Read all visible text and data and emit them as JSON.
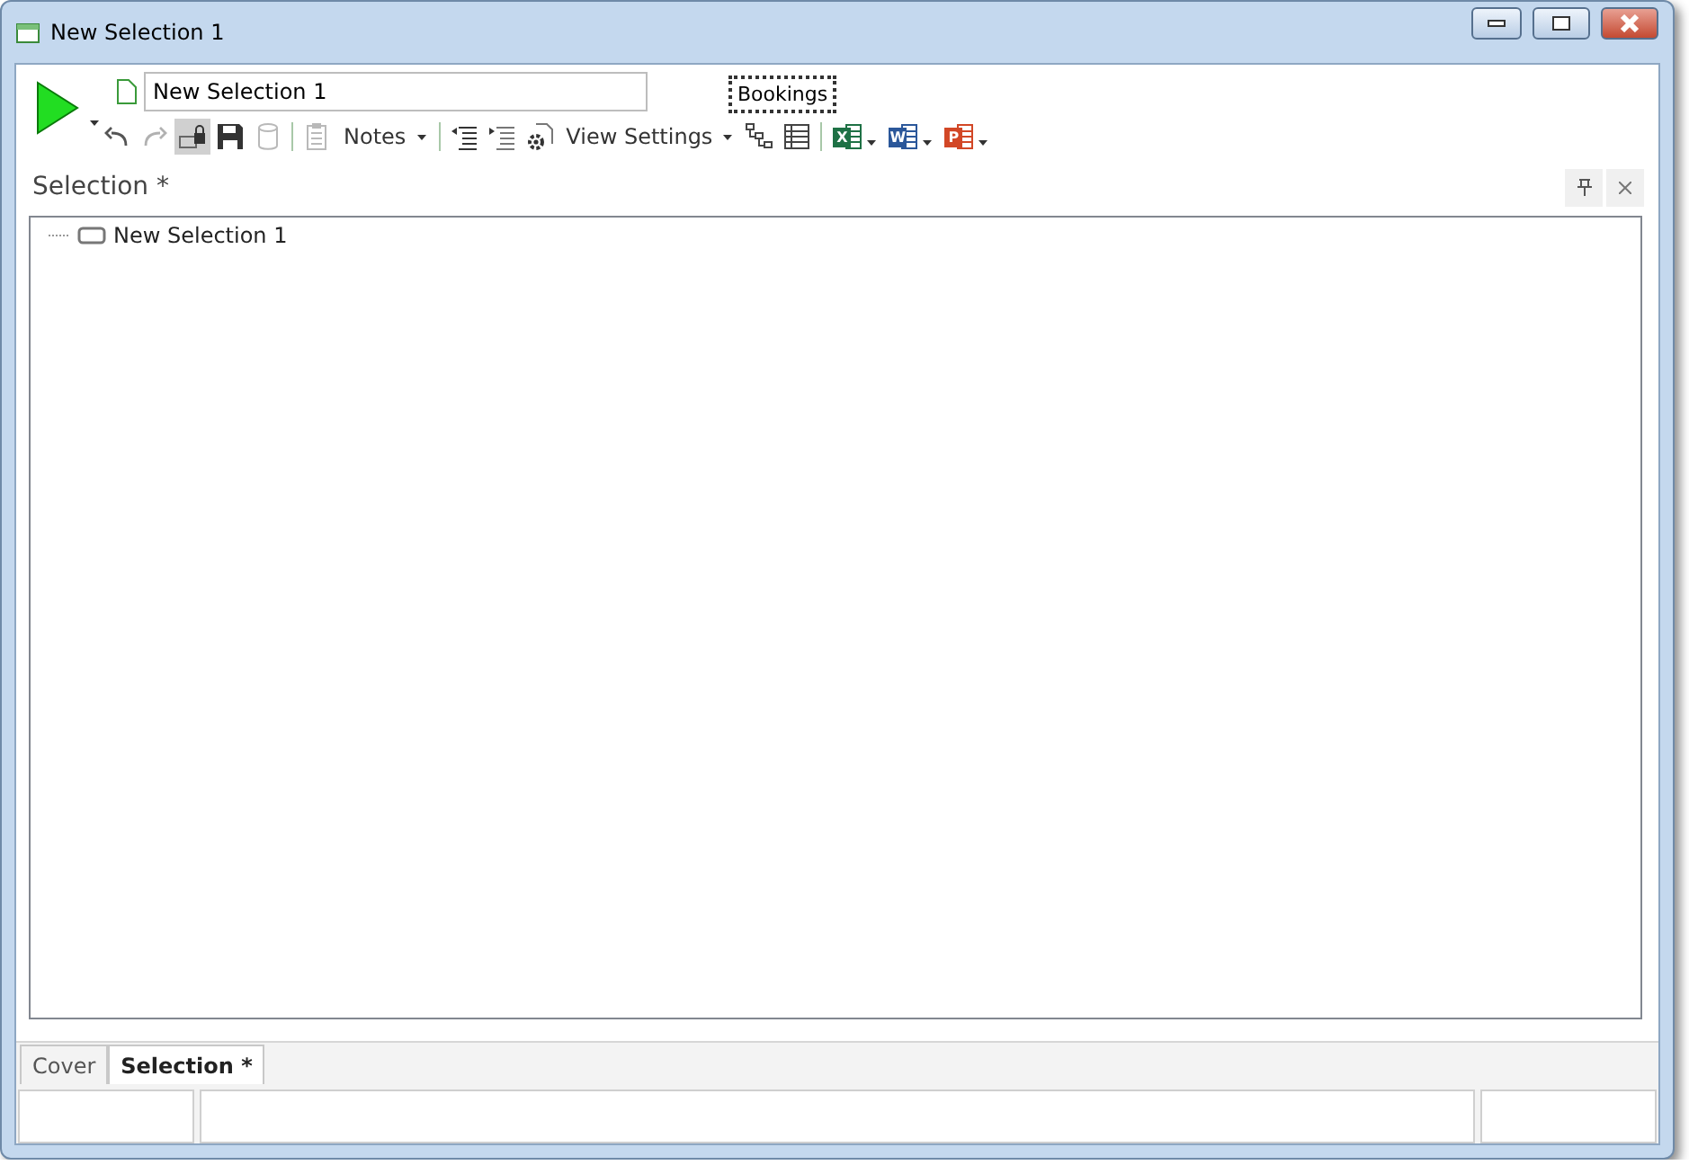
{
  "window": {
    "title": "New Selection 1"
  },
  "name_field": {
    "value": "New Selection 1"
  },
  "tooltip": {
    "text": "Bookings"
  },
  "toolbar": [
    {
      "kind": "undo",
      "pressed": false,
      "disabled": false
    },
    {
      "kind": "redo",
      "pressed": false,
      "disabled": true
    },
    {
      "kind": "lock",
      "pressed": true,
      "disabled": false
    },
    {
      "kind": "save",
      "pressed": false,
      "disabled": false
    },
    {
      "kind": "database",
      "pressed": false,
      "disabled": true
    },
    {
      "kind": "separator"
    },
    {
      "kind": "clipboard",
      "pressed": false,
      "disabled": true
    },
    {
      "kind": "menu",
      "label": "Notes"
    },
    {
      "kind": "separator"
    },
    {
      "kind": "outdent",
      "pressed": false,
      "disabled": false
    },
    {
      "kind": "indent",
      "pressed": false,
      "disabled": false
    },
    {
      "kind": "gear",
      "pressed": false,
      "disabled": false
    },
    {
      "kind": "menu",
      "label": "View Settings"
    },
    {
      "kind": "tree",
      "pressed": false,
      "disabled": false
    },
    {
      "kind": "grid",
      "pressed": false,
      "disabled": false
    },
    {
      "kind": "separator"
    },
    {
      "kind": "office",
      "letter": "X",
      "color": "#1e7145"
    },
    {
      "kind": "office",
      "letter": "W",
      "color": "#2b579a"
    },
    {
      "kind": "office",
      "letter": "P",
      "color": "#d24726"
    }
  ],
  "panel": {
    "title": "Selection *"
  },
  "tree": [
    {
      "label": "New Selection 1"
    }
  ],
  "tabs": [
    {
      "label": "Cover",
      "selected": false
    },
    {
      "label": "Selection *",
      "selected": true
    }
  ]
}
